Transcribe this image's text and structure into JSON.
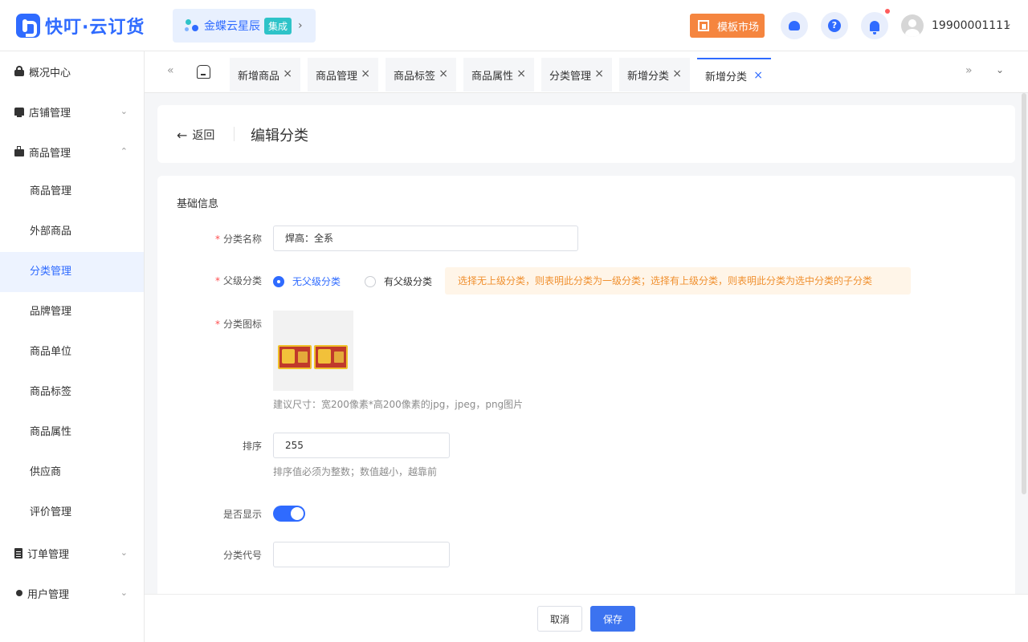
{
  "header": {
    "logo_text": "快叮·云订货",
    "kingdee": {
      "label": "金蝶云星辰",
      "badge": "集成",
      "arrow": "›"
    },
    "market_label": "模板市场",
    "user_phone": "19900001111",
    "user_caret": "⌄",
    "colors": {
      "brand": "#2f6bff",
      "market": "#f5853f"
    }
  },
  "sidebar": {
    "groups": [
      {
        "label": "概况中心",
        "icon": "lock-icon"
      },
      {
        "label": "店铺管理",
        "icon": "shop-icon",
        "chevron": "⌄"
      },
      {
        "label": "商品管理",
        "icon": "bag-icon",
        "chevron": "⌃"
      },
      {
        "label": "订单管理",
        "icon": "clipboard-icon",
        "chevron": "⌄"
      },
      {
        "label": "用户管理",
        "icon": "person-icon",
        "chevron": "⌄"
      }
    ],
    "items": [
      "商品管理",
      "外部商品",
      "分类管理",
      "品牌管理",
      "商品单位",
      "商品标签",
      "商品属性",
      "供应商",
      "评价管理"
    ],
    "active_item": "分类管理"
  },
  "tabs": {
    "prev": "«",
    "next": "»",
    "menu": "⌄",
    "close": "×",
    "items": [
      "新增商品",
      "商品管理",
      "商品标签",
      "商品属性",
      "分类管理",
      "新增分类",
      "新增分类"
    ],
    "active_index": 6
  },
  "page": {
    "back_arrow": "←",
    "back_label": "返回",
    "title": "编辑分类"
  },
  "form": {
    "section_title": "基础信息",
    "required_mark": "*",
    "name_label": "分类名称",
    "name_value": "焊高：全系",
    "parent_label": "父级分类",
    "parent_options": [
      "无父级分类",
      "有父级分类"
    ],
    "parent_selected": "无父级分类",
    "parent_tip": "选择无上级分类，则表明此分类为一级分类；选择有上级分类，则表明此分类为选中分类的子分类",
    "icon_label": "分类图标",
    "icon_hint": "建议尺寸：宽200像素*高200像素的jpg，jpeg，png图片",
    "sort_label": "排序",
    "sort_value": "255",
    "sort_hint": "排序值必须为整数；数值越小，越靠前",
    "show_label": "是否显示",
    "show_enabled": true,
    "code_label": "分类代号",
    "code_value": ""
  },
  "footer": {
    "cancel_label": "取消",
    "save_label": "保存"
  }
}
